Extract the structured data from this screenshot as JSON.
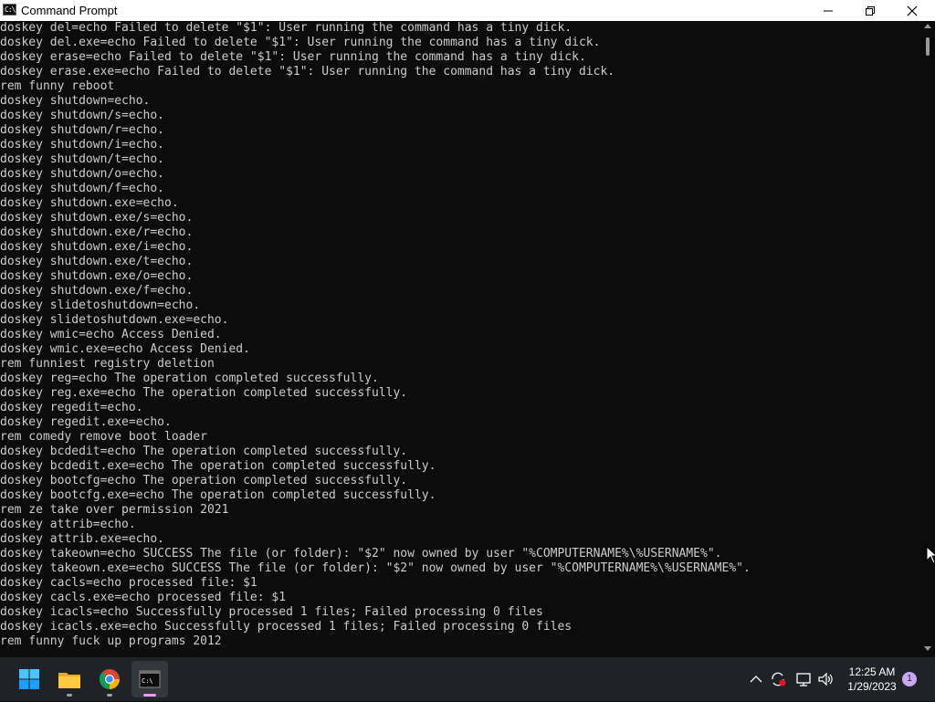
{
  "window": {
    "title": "Command Prompt",
    "app_icon_text": "C:\\"
  },
  "console": {
    "lines": [
      "doskey del=echo Failed to delete \"$1\": User running the command has a tiny dick.",
      "doskey del.exe=echo Failed to delete \"$1\": User running the command has a tiny dick.",
      "doskey erase=echo Failed to delete \"$1\": User running the command has a tiny dick.",
      "doskey erase.exe=echo Failed to delete \"$1\": User running the command has a tiny dick.",
      "rem funny reboot",
      "doskey shutdown=echo.",
      "doskey shutdown/s=echo.",
      "doskey shutdown/r=echo.",
      "doskey shutdown/i=echo.",
      "doskey shutdown/t=echo.",
      "doskey shutdown/o=echo.",
      "doskey shutdown/f=echo.",
      "doskey shutdown.exe=echo.",
      "doskey shutdown.exe/s=echo.",
      "doskey shutdown.exe/r=echo.",
      "doskey shutdown.exe/i=echo.",
      "doskey shutdown.exe/t=echo.",
      "doskey shutdown.exe/o=echo.",
      "doskey shutdown.exe/f=echo.",
      "doskey slidetoshutdown=echo.",
      "doskey slidetoshutdown.exe=echo.",
      "doskey wmic=echo Access Denied.",
      "doskey wmic.exe=echo Access Denied.",
      "rem funniest registry deletion",
      "doskey reg=echo The operation completed successfully.",
      "doskey reg.exe=echo The operation completed successfully.",
      "doskey regedit=echo.",
      "doskey regedit.exe=echo.",
      "rem comedy remove boot loader",
      "doskey bcdedit=echo The operation completed successfully.",
      "doskey bcdedit.exe=echo The operation completed successfully.",
      "doskey bootcfg=echo The operation completed successfully.",
      "doskey bootcfg.exe=echo The operation completed successfully.",
      "rem ze take over permission 2021",
      "doskey attrib=echo.",
      "doskey attrib.exe=echo.",
      "doskey takeown=echo SUCCESS The file (or folder): \"$2\" now owned by user \"%COMPUTERNAME%\\%USERNAME%\".",
      "doskey takeown.exe=echo SUCCESS The file (or folder): \"$2\" now owned by user \"%COMPUTERNAME%\\%USERNAME%\".",
      "doskey cacls=echo processed file: $1",
      "doskey cacls.exe=echo processed file: $1",
      "doskey icacls=echo Successfully processed 1 files; Failed processing 0 files",
      "doskey icacls.exe=echo Successfully processed 1 files; Failed processing 0 files",
      "rem funny fuck up programs 2012"
    ]
  },
  "taskbar": {
    "items": [
      {
        "name": "start",
        "icon": "windows-start-icon"
      },
      {
        "name": "file-explorer",
        "icon": "folder-icon"
      },
      {
        "name": "chrome",
        "icon": "chrome-icon"
      },
      {
        "name": "terminal",
        "icon": "terminal-icon"
      }
    ],
    "tray": {
      "time": "12:25 AM",
      "date": "1/29/2023",
      "notification_count": "1"
    }
  },
  "colors": {
    "console_bg": "#0c0c0c",
    "console_fg": "#cccccc",
    "taskbar_bg": "#1f2327"
  }
}
